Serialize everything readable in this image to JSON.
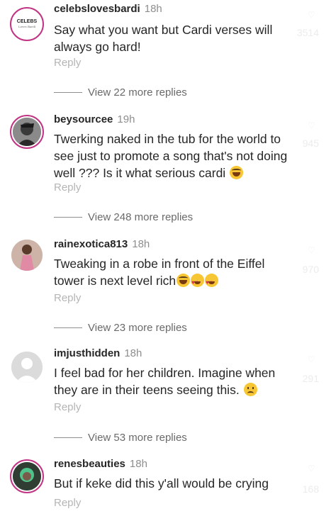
{
  "comments": [
    {
      "username": "celebslovesbardi",
      "time": "18h",
      "text": "Say what you want but Cardi verses will always go hard!",
      "reply_label": "Reply",
      "likes": "3514",
      "avatar_text": "CELEBS",
      "avatar_sub": "Loves Bardi",
      "view_more": "View 22 more replies"
    },
    {
      "username": "beysourcee",
      "time": "19h",
      "text": "Twerking naked in the tub for the world to see just to promote a song that's not doing well ??? Is it what serious cardi",
      "reply_label": "Reply",
      "likes": "945",
      "view_more": "View 248 more replies"
    },
    {
      "username": "rainexotica813",
      "time": "18h",
      "text": "Tweaking in a robe in front of the Eiffel tower is next level rich",
      "reply_label": "Reply",
      "likes": "970",
      "view_more": "View 23 more replies"
    },
    {
      "username": "imjusthidden",
      "time": "18h",
      "text": "I feel bad for her children. Imagine when they are in their teens seeing this.",
      "reply_label": "Reply",
      "likes": "291",
      "view_more": "View 53 more replies"
    },
    {
      "username": "renesbeauties",
      "time": "18h",
      "text": "But if keke did this y'all would be crying",
      "reply_label": "Reply",
      "likes": "168"
    }
  ],
  "colors": {
    "ring": "#c13584",
    "username": "#262626",
    "meta": "#8e8e8e",
    "reply": "#b5b5b5"
  }
}
